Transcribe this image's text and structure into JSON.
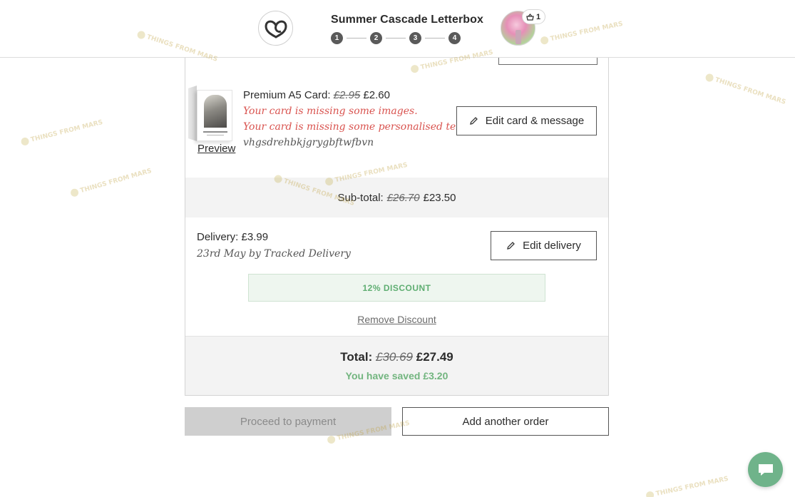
{
  "header": {
    "title": "Summer Cascade Letterbox",
    "steps": [
      "1",
      "2",
      "3",
      "4"
    ],
    "basket_count": "1"
  },
  "card": {
    "title_label": "Premium A5 Card:",
    "price_old": "£2.95",
    "price_new": "£2.60",
    "warning_images": "Your card is missing some images.",
    "warning_text": "Your card is missing some personalised text.",
    "message": "vhgsdrehbkjgrygbftwfbvn",
    "preview_label": "Preview",
    "edit_label": "Edit card & message"
  },
  "subtotal": {
    "label": "Sub-total:",
    "old": "£26.70",
    "new": "£23.50"
  },
  "delivery": {
    "label": "Delivery: £3.99",
    "detail": "23rd May by Tracked Delivery",
    "edit_label": "Edit delivery"
  },
  "discount": {
    "badge": "12% DISCOUNT",
    "remove_label": "Remove Discount"
  },
  "total": {
    "label": "Total:",
    "old": "£30.69",
    "new": "£27.49",
    "saved": "You have saved £3.20"
  },
  "actions": {
    "proceed_label": "Proceed to payment",
    "add_order_label": "Add another order"
  },
  "watermark_text": "THINGS FROM MARS",
  "colors": {
    "warning": "#d9534f",
    "success": "#5fae72",
    "disabled_bg": "#cfcfcf",
    "band_bg": "#f3f3f3",
    "chat": "#6fb38a"
  }
}
